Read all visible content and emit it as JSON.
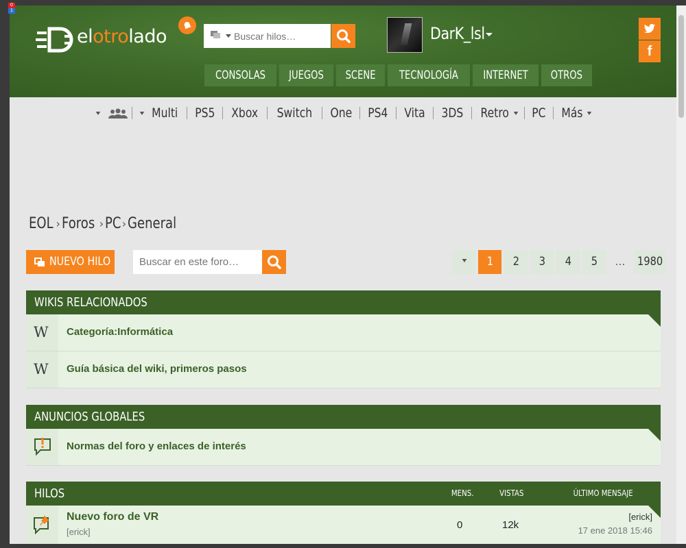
{
  "header": {
    "logo_prefix": "el",
    "logo_accent": "otro",
    "logo_suffix": "lado",
    "search_placeholder": "Buscar hilos…",
    "username": "DarK_lsl",
    "twitter_icon": "twitter-icon",
    "facebook_letter": "f"
  },
  "main_nav": [
    "CONSOLAS",
    "JUEGOS",
    "SCENE",
    "TECNOLOGÍA",
    "INTERNET",
    "OTROS"
  ],
  "platforms": [
    "Multi",
    "PS5",
    "Xbox",
    "Switch",
    "One",
    "PS4",
    "Vita",
    "3DS",
    "Retro",
    "PC",
    "Más"
  ],
  "breadcrumb": [
    "EOL",
    "Foros",
    "PC",
    "General"
  ],
  "toolbar": {
    "new_thread_label": "NUEVO HILO",
    "forum_search_placeholder": "Buscar en este foro…"
  },
  "pager": {
    "pages": [
      "1",
      "2",
      "3",
      "4",
      "5"
    ],
    "ellipsis": "…",
    "last": "1980",
    "current": "1"
  },
  "wikis": {
    "title": "WIKIS RELACIONADOS",
    "items": [
      "Categoría:Informática",
      "Guía básica del wiki, primeros pasos"
    ]
  },
  "announcements": {
    "title": "ANUNCIOS GLOBALES",
    "items": [
      "Normas del foro y enlaces de interés"
    ]
  },
  "threads": {
    "title": "HILOS",
    "col_messages": "MENS.",
    "col_views": "VISTAS",
    "col_last": "ÚLTIMO MENSAJE",
    "rows": [
      {
        "title": "Nuevo foro de VR",
        "author": "[erick]",
        "messages": "0",
        "views": "12k",
        "last_user": "[erick]",
        "last_date": "17 ene 2018 15:46"
      }
    ]
  },
  "colors": {
    "accent": "#f5841f",
    "header_green": "#3e6a2a",
    "section_green": "#3b6127"
  }
}
